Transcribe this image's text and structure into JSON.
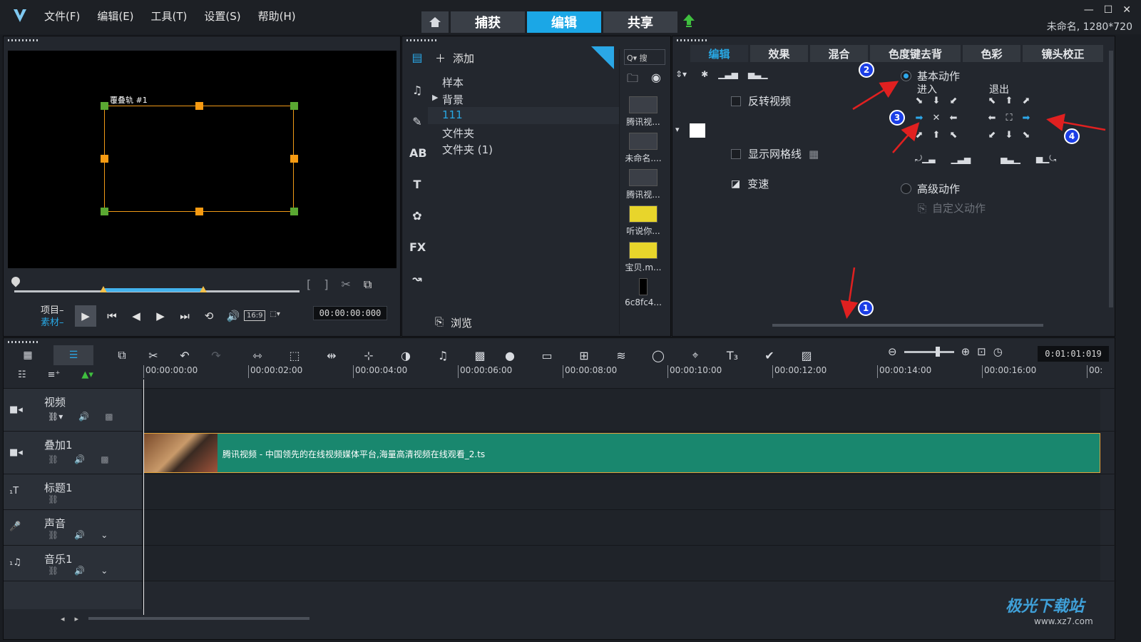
{
  "titlebar": {
    "menu": [
      "文件(F)",
      "编辑(E)",
      "工具(T)",
      "设置(S)",
      "帮助(H)"
    ],
    "nav_tabs": [
      "捕获",
      "编辑",
      "共享"
    ],
    "active_tab": "编辑",
    "project_info": "未命名, 1280*720",
    "window_controls": [
      "—",
      "☐",
      "✕"
    ]
  },
  "preview": {
    "overlay_label": "覆叠轨 #1",
    "project_label": "项目",
    "clip_label": "素材",
    "aspect": "16:9",
    "timecode": "00:00:00:000"
  },
  "library": {
    "add_label": "添加",
    "folders": [
      "样本",
      "背景",
      "111",
      "文件夹",
      "文件夹 (1)"
    ],
    "selected_folder": "111",
    "browse_label": "浏览",
    "search_placeholder": "Q▾  搜",
    "thumbnails": [
      {
        "caption": "腾讯视...",
        "style": "dark"
      },
      {
        "caption": "未命名....",
        "style": "dark"
      },
      {
        "caption": "腾讯视...",
        "style": "dark"
      },
      {
        "caption": "听说你...",
        "style": "yellow"
      },
      {
        "caption": "宝贝.m...",
        "style": "yellow"
      },
      {
        "caption": "6c8fc4...",
        "style": "dark"
      }
    ],
    "side_icons": [
      "media-icon",
      "audio-icon",
      "instant-project-icon",
      "transition-icon",
      "title-icon",
      "graphic-icon",
      "filter-icon",
      "path-icon"
    ]
  },
  "options": {
    "tabs": [
      "编辑",
      "效果",
      "混合",
      "色度键去背",
      "色彩",
      "镜头校正"
    ],
    "active_tab": "编辑",
    "reverse_video": "反转视频",
    "show_grid": "显示网格线",
    "speed": "变速",
    "basic_motion": "基本动作",
    "advanced_motion": "高级动作",
    "custom_motion": "自定义动作",
    "entry_label": "进入",
    "exit_label": "退出",
    "entry_arrows": [
      "⬊",
      "⬇",
      "⬋",
      "➡",
      "✕",
      "⬅",
      "⬈",
      "⬆",
      "⬉"
    ],
    "exit_arrows": [
      "⬉",
      "⬆",
      "⬈",
      "⬅",
      "⛶",
      "➡",
      "⬋",
      "⬇",
      "⬊"
    ],
    "entry_highlight": 3,
    "exit_highlight": 5,
    "badges": [
      "1",
      "2",
      "3",
      "4"
    ],
    "annotation_color": "#e02020"
  },
  "timeline": {
    "ruler_ticks": [
      "00:00:00:00",
      "00:00:02:00",
      "00:00:04:00",
      "00:00:06:00",
      "00:00:08:00",
      "00:00:10:00",
      "00:00:12:00",
      "00:00:14:00",
      "00:00:16:00",
      "00:"
    ],
    "duration": "0:01:01:019",
    "tracks": [
      {
        "name": "视频",
        "icon": "video-track-icon"
      },
      {
        "name": "叠加1",
        "icon": "overlay-track-icon"
      },
      {
        "name": "标题1",
        "icon": "title-track-icon"
      },
      {
        "name": "声音",
        "icon": "voice-track-icon"
      },
      {
        "name": "音乐1",
        "icon": "music-track-icon"
      }
    ],
    "clip_title": "腾讯视频 - 中国领先的在线视频媒体平台,海量高清视频在线观看_2.ts",
    "clip_color": "#19876e"
  },
  "watermark": {
    "brand": "极光下载站",
    "url": "www.xz7.com"
  }
}
